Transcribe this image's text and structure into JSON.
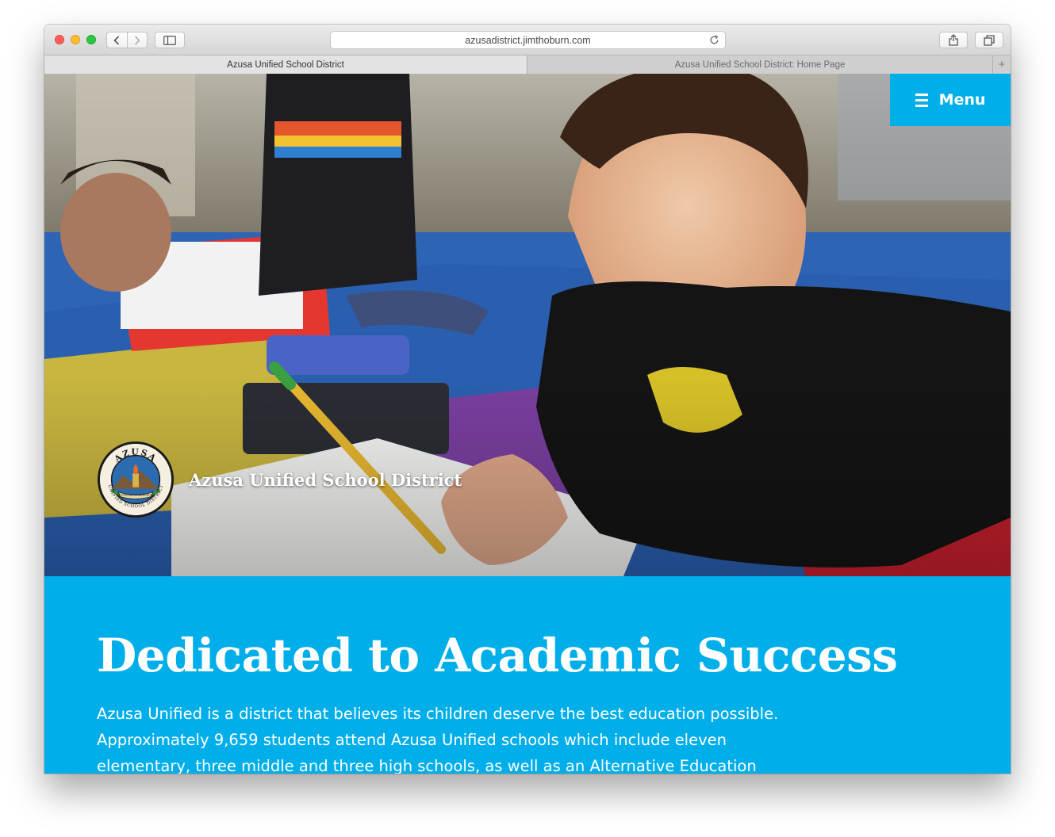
{
  "browser": {
    "url": "azusadistrict.jimthoburn.com",
    "tabs": [
      {
        "title": "Azusa Unified School District",
        "active": true
      },
      {
        "title": "Azusa Unified School District: Home Page",
        "active": false
      }
    ],
    "new_tab_symbol": "+",
    "icons": [
      "back-icon",
      "forward-icon",
      "sidebar-icon",
      "reload-icon",
      "share-icon",
      "tabs-overview-icon"
    ]
  },
  "header": {
    "menu_label": "Menu",
    "site_name": "Azusa Unified School District",
    "seal": {
      "ring_top": "AZUSA",
      "ring_bottom": "UNIFIED SCHOOL DISTRICT",
      "banner": "Excellence in Education"
    }
  },
  "intro": {
    "headline": "Dedicated to Academic Success",
    "body": "Azusa Unified is a district that believes its children deserve the best education possible. Approximately 9,659 students attend Azusa Unified schools which include eleven elementary, three middle and three high schools, as well as an Alternative Education Center."
  },
  "colors": {
    "accent": "#00aeea",
    "text_on_accent": "#ffffff"
  }
}
